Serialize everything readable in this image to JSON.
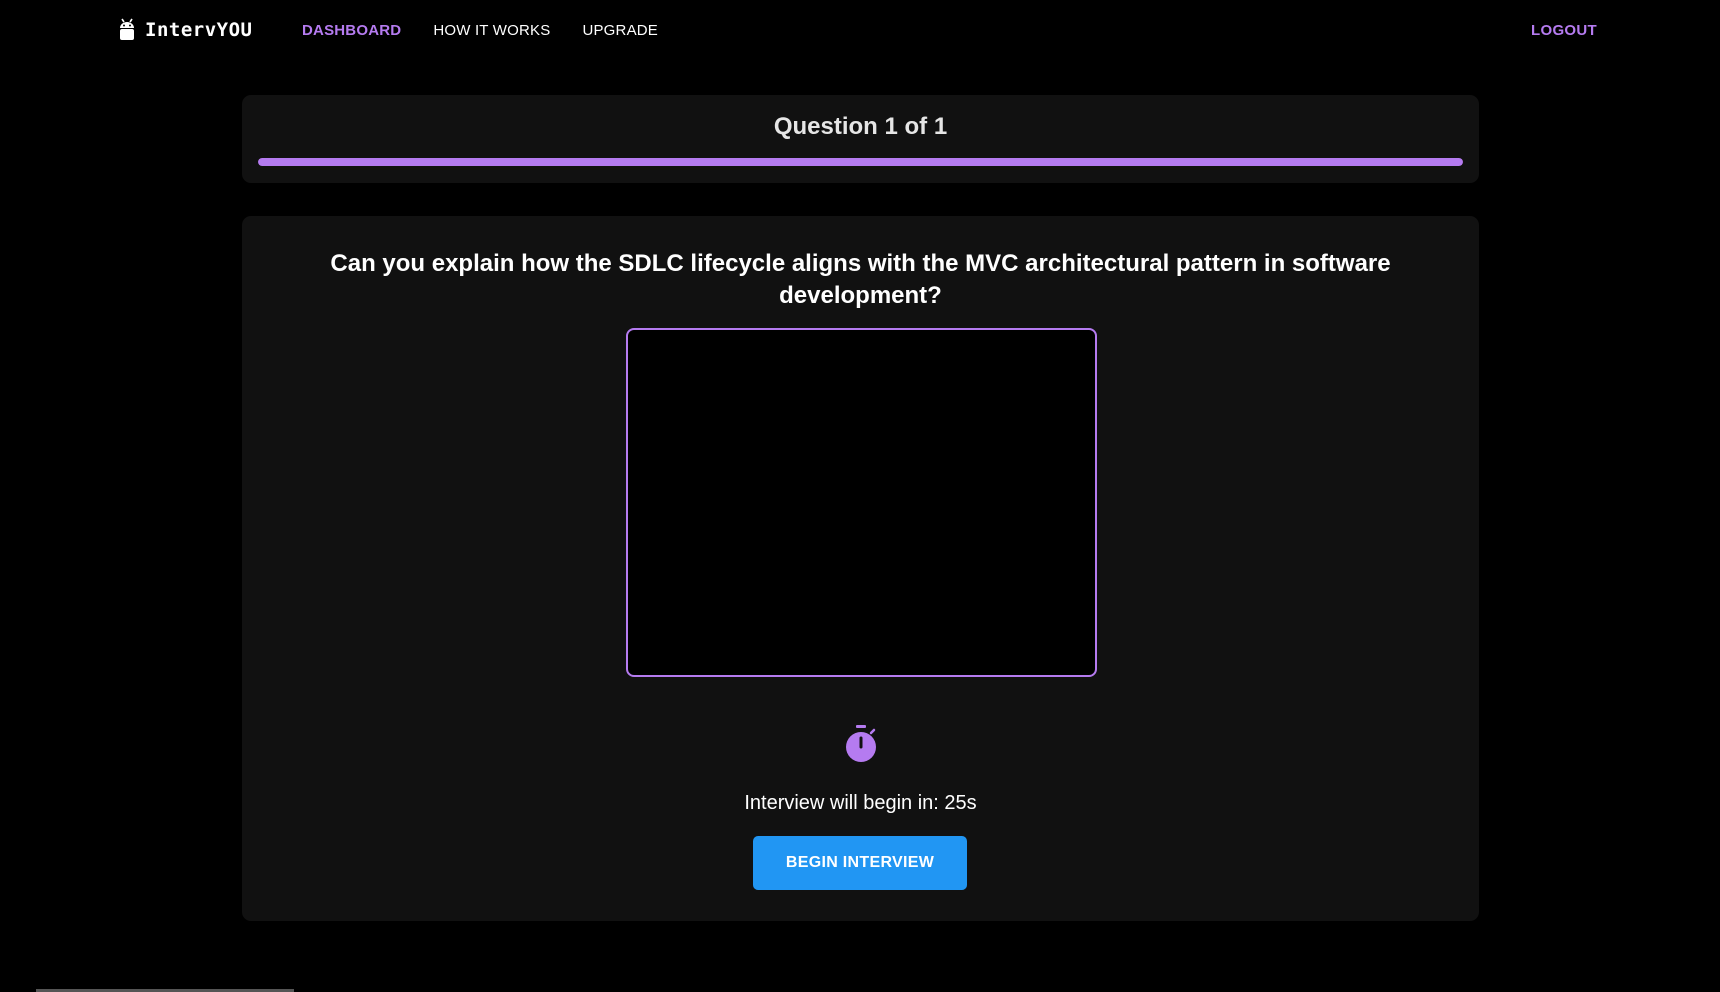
{
  "nav": {
    "brand_name": "IntervYOU",
    "brand_icon": "android-robot-icon",
    "links": [
      {
        "label": "DASHBOARD",
        "active": true
      },
      {
        "label": "HOW IT WORKS",
        "active": false
      },
      {
        "label": "UPGRADE",
        "active": false
      }
    ],
    "logout_label": "LOGOUT"
  },
  "progress": {
    "title": "Question 1 of 1",
    "fraction": 1.0
  },
  "question": {
    "text": "Can you explain how the SDLC lifecycle aligns with the MVC architectural pattern in software development?"
  },
  "timer": {
    "icon": "stopwatch-icon",
    "countdown_text": "Interview will begin in: 25s"
  },
  "actions": {
    "begin_label": "BEGIN INTERVIEW"
  },
  "colors": {
    "accent": "#b57bf0",
    "primary_button": "#2196f3",
    "background": "#000000",
    "card": "#111111"
  }
}
